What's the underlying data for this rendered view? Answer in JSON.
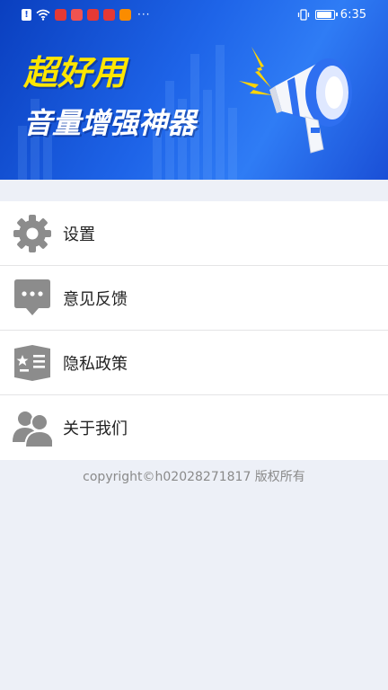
{
  "status_bar": {
    "time": "6:35",
    "battery_level": 0.8,
    "overflow_indicator": "···"
  },
  "banner": {
    "line1": "超好用",
    "line2": "音量增强神器",
    "colors": {
      "accent": "#ffe600",
      "background": "#1e64e8"
    }
  },
  "menu": {
    "items": [
      {
        "label": "设置",
        "icon": "gear-icon"
      },
      {
        "label": "意见反馈",
        "icon": "chat-bubble-icon"
      },
      {
        "label": "隐私政策",
        "icon": "open-book-icon"
      },
      {
        "label": "关于我们",
        "icon": "users-icon"
      }
    ]
  },
  "footer": {
    "copyright": "copyright©h02028271817 版权所有"
  }
}
